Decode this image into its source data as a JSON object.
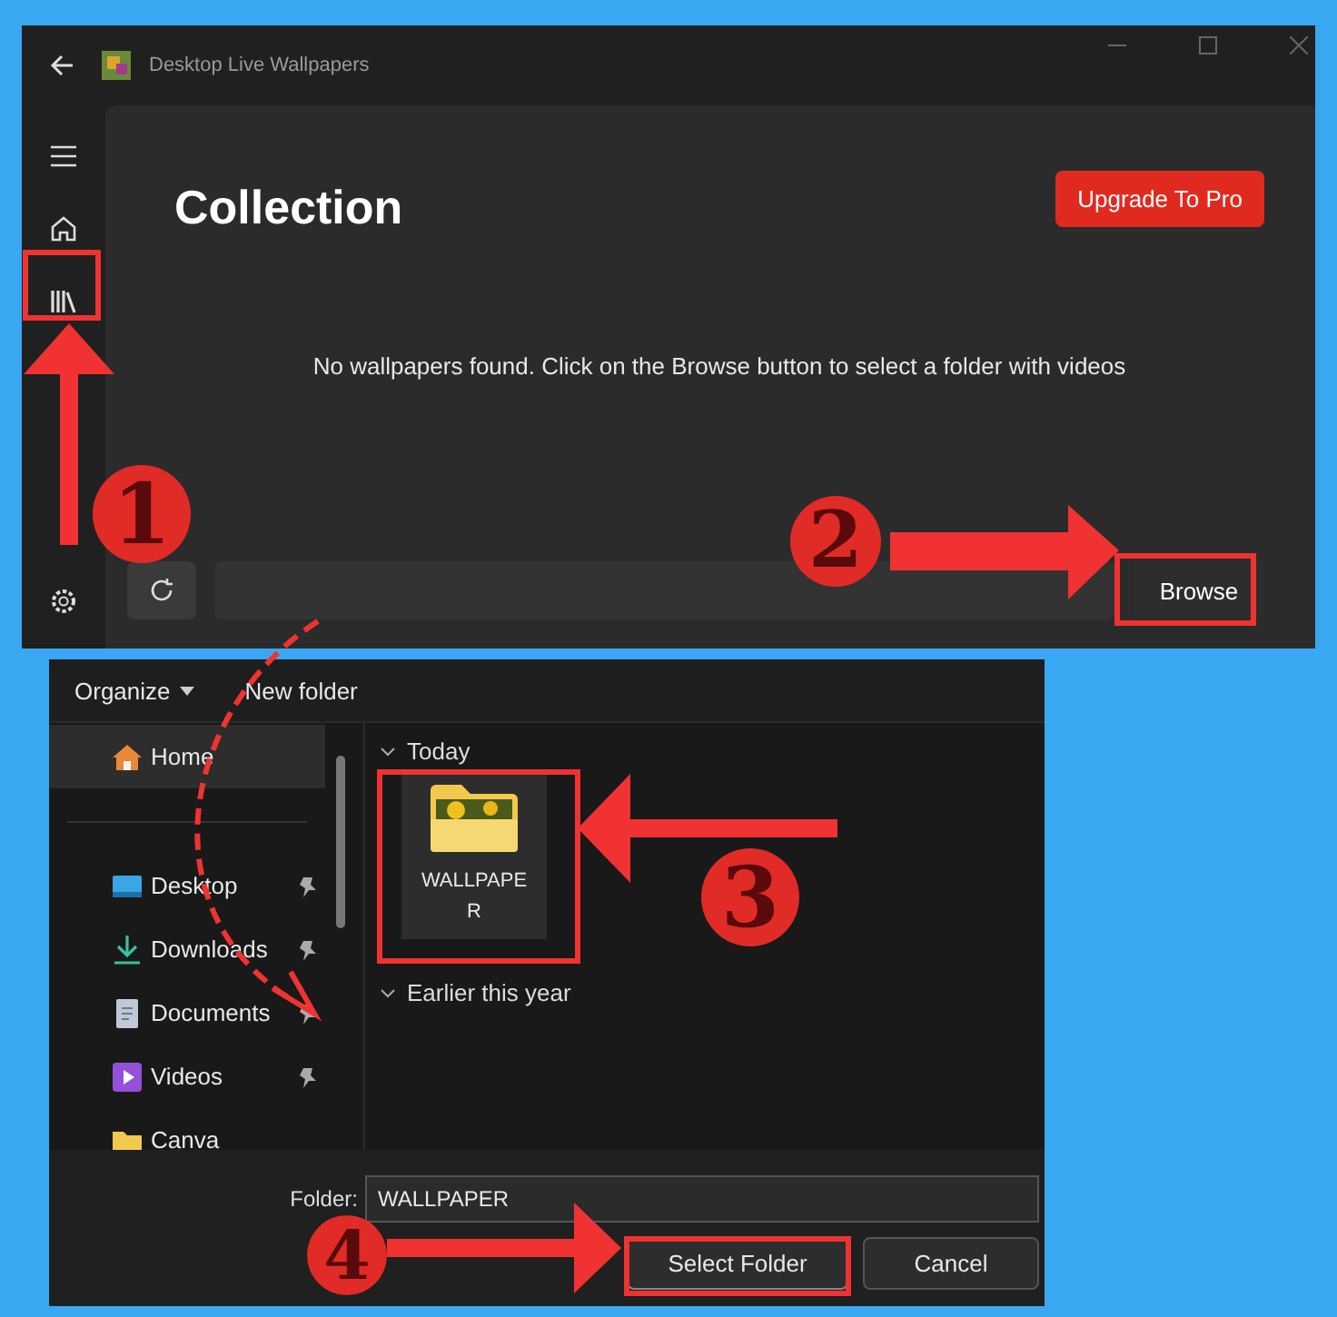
{
  "app": {
    "title": "Desktop Live Wallpapers",
    "rail": [
      {
        "kind": "menu"
      },
      {
        "kind": "home"
      },
      {
        "kind": "library"
      },
      {
        "kind": "settings"
      }
    ],
    "heading": "Collection",
    "upgrade_button": "Upgrade To Pro",
    "empty_message": "No wallpapers found. Click on the Browse button to select a folder with videos",
    "browse_button": "Browse"
  },
  "dialog": {
    "toolbar": [
      {
        "label": "Organize",
        "dropdown": true
      },
      {
        "label": "New folder",
        "dropdown": false
      }
    ],
    "nav": [
      {
        "label": "Home",
        "kind": "home",
        "selected": true,
        "pinned": false
      },
      {
        "label": "Desktop",
        "kind": "desktop",
        "selected": false,
        "pinned": true
      },
      {
        "label": "Downloads",
        "kind": "downloads",
        "selected": false,
        "pinned": true
      },
      {
        "label": "Documents",
        "kind": "documents",
        "selected": false,
        "pinned": true
      },
      {
        "label": "Videos",
        "kind": "videos",
        "selected": false,
        "pinned": true
      },
      {
        "label": "Canva",
        "kind": "folder",
        "selected": false,
        "pinned": false
      }
    ],
    "groups": [
      {
        "label": "Today",
        "expanded": true,
        "items": [
          {
            "name": "WALLPAPER",
            "selected": true
          }
        ]
      },
      {
        "label": "Earlier this year",
        "expanded": true
      }
    ],
    "folder_label": "Folder:",
    "folder_value": "WALLPAPER",
    "buttons": [
      {
        "label": "Select Folder",
        "kind": "primary"
      },
      {
        "label": "Cancel",
        "kind": "secondary"
      }
    ]
  },
  "annotations": {
    "steps": [
      "1",
      "2",
      "3",
      "4"
    ]
  }
}
